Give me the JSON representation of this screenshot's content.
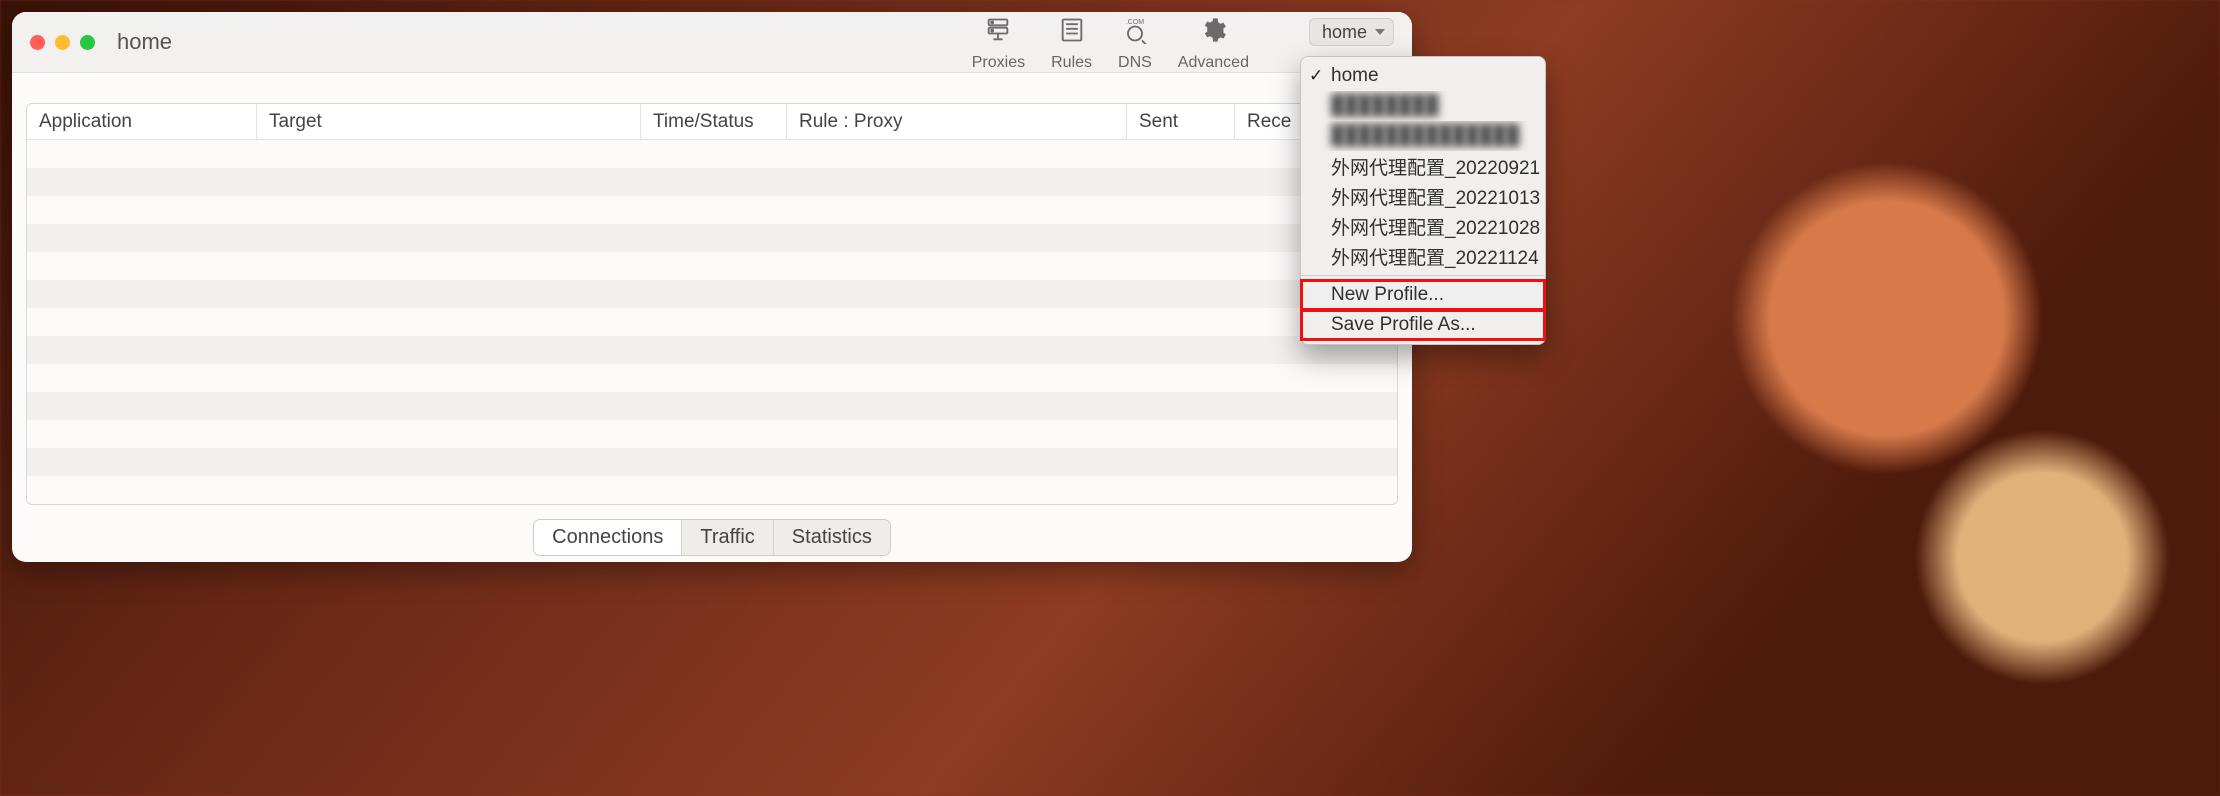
{
  "window": {
    "title": "home"
  },
  "toolbar": {
    "proxies": "Proxies",
    "rules": "Rules",
    "dns": "DNS",
    "advanced": "Advanced"
  },
  "profile_select": {
    "value": "home"
  },
  "columns": {
    "application": "Application",
    "target": "Target",
    "time_status": "Time/Status",
    "rule_proxy": "Rule : Proxy",
    "sent": "Sent",
    "received": "Rece"
  },
  "footer_tabs": {
    "connections": "Connections",
    "traffic": "Traffic",
    "statistics": "Statistics"
  },
  "dropdown": {
    "items": [
      {
        "label": "home",
        "checked": true
      },
      {
        "label": "████████",
        "blurred": true
      },
      {
        "label": "██████████████",
        "blurred": true
      },
      {
        "label": "外网代理配置_20220921"
      },
      {
        "label": "外网代理配置_20221013"
      },
      {
        "label": "外网代理配置_20221028"
      },
      {
        "label": "外网代理配置_20221124"
      }
    ],
    "new_profile": "New Profile...",
    "save_profile_as": "Save Profile As..."
  }
}
